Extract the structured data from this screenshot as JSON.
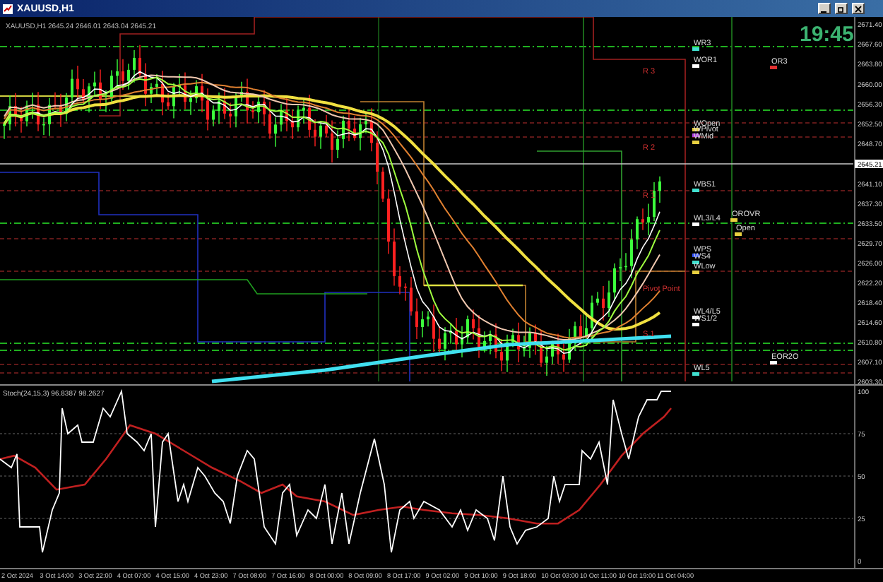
{
  "window": {
    "title": "XAUUSD,H1"
  },
  "chart": {
    "info": "XAUUSD,H1 2645.24 2646.01 2643.04 2645.21",
    "clock": "19:45",
    "price_ticks": [
      {
        "label": "2671.40",
        "current": false
      },
      {
        "label": "2667.60",
        "current": false
      },
      {
        "label": "2663.80",
        "current": false
      },
      {
        "label": "2660.00",
        "current": false
      },
      {
        "label": "2656.30",
        "current": false
      },
      {
        "label": "2652.50",
        "current": false
      },
      {
        "label": "2648.70",
        "current": false
      },
      {
        "label": "2645.21",
        "current": true
      },
      {
        "label": "2641.10",
        "current": false
      },
      {
        "label": "2637.30",
        "current": false
      },
      {
        "label": "2633.50",
        "current": false
      },
      {
        "label": "2629.70",
        "current": false
      },
      {
        "label": "2626.00",
        "current": false
      },
      {
        "label": "2622.20",
        "current": false
      },
      {
        "label": "2618.40",
        "current": false
      },
      {
        "label": "2614.60",
        "current": false
      },
      {
        "label": "2610.80",
        "current": false
      },
      {
        "label": "2607.10",
        "current": false
      },
      {
        "label": "2603.30",
        "current": false
      }
    ],
    "level_labels": [
      {
        "text": "WR3",
        "color": "#40e0d0"
      },
      {
        "text": "WOR1",
        "color": "#ffffff"
      },
      {
        "text": "OR3",
        "color": "#e03030"
      },
      {
        "text": "WOpen",
        "color": "#e8d040"
      },
      {
        "text": "WPivot",
        "color": "#b040e0"
      },
      {
        "text": "WMid",
        "color": "#e8d040"
      },
      {
        "text": "WBS1",
        "color": "#40e0d0"
      },
      {
        "text": "WL3/L4",
        "color": "#ffffff"
      },
      {
        "text": "OROVR",
        "color": "#e8d040"
      },
      {
        "text": "Open",
        "color": "#e8d040"
      },
      {
        "text": "WPS",
        "color": "#3050ff"
      },
      {
        "text": "WS4",
        "color": "#40e0d0"
      },
      {
        "text": "WLow",
        "color": "#e8d040"
      },
      {
        "text": "WL4/L5",
        "color": "#ffffff"
      },
      {
        "text": "WS1/2",
        "color": "#ffffff"
      },
      {
        "text": "EOR2O",
        "color": "#ffffff"
      },
      {
        "text": "WL5",
        "color": "#40e0d0"
      }
    ],
    "zone_labels": [
      "R 3",
      "R 2",
      "R 1",
      "Pivot Point",
      "S 1"
    ]
  },
  "indicator": {
    "label": "Stoch(24,15,3) 96.8387 98.2627",
    "ticks": [
      "100",
      "75",
      "50",
      "25",
      "0"
    ]
  },
  "time_axis": [
    "2 Oct 2024",
    "3 Oct 14:00",
    "3 Oct 22:00",
    "4 Oct 07:00",
    "4 Oct 15:00",
    "4 Oct 23:00",
    "7 Oct 08:00",
    "7 Oct 16:00",
    "8 Oct 00:00",
    "8 Oct 09:00",
    "8 Oct 17:00",
    "9 Oct 02:00",
    "9 Oct 10:00",
    "9 Oct 18:00",
    "10 Oct 03:00",
    "10 Oct 11:00",
    "10 Oct 19:00",
    "11 Oct 04:00"
  ]
}
